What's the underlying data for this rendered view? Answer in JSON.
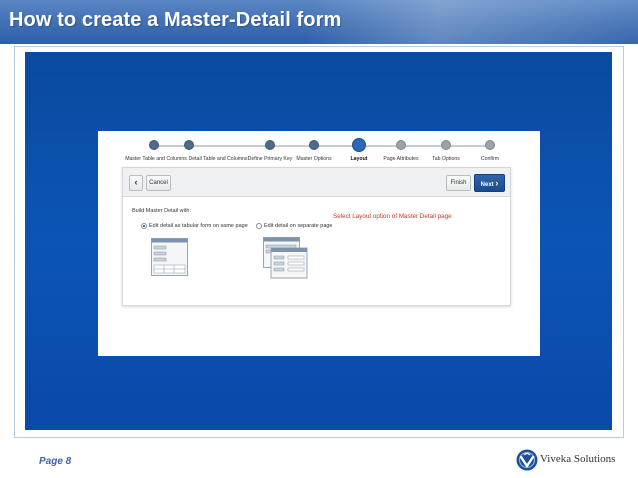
{
  "slide": {
    "title": "How to create a Master-Detail form",
    "page_label": "Page 8",
    "brand": "Viveka Solutions",
    "colors": {
      "header": "#3f6fb4",
      "stage": "#0c55b5",
      "next_button": "#1b4b8f",
      "hint": "#c0392b"
    }
  },
  "wizard": {
    "steps": [
      {
        "label": "Master Table and Columns",
        "state": "done"
      },
      {
        "label": "Detail Table and Columns",
        "state": "done"
      },
      {
        "label": "Define Primary Key",
        "state": "done"
      },
      {
        "label": "Master Options",
        "state": "done"
      },
      {
        "label": "Layout",
        "state": "current"
      },
      {
        "label": "Page Attributes",
        "state": "pending"
      },
      {
        "label": "Tab Options",
        "state": "pending"
      },
      {
        "label": "Confirm",
        "state": "pending"
      }
    ],
    "back_icon": "chevron-left-icon",
    "back_glyph": "‹",
    "cancel_label": "Cancel",
    "finish_label": "Finish",
    "next_label": "Next",
    "next_glyph": "›",
    "build_label": "Build Master Detail with:",
    "options": [
      {
        "label": "Edit detail as tabular form on same page",
        "checked": true
      },
      {
        "label": "Edit detail on separate page",
        "checked": false
      }
    ],
    "hint": "Select Layout option of Master Detail page"
  }
}
